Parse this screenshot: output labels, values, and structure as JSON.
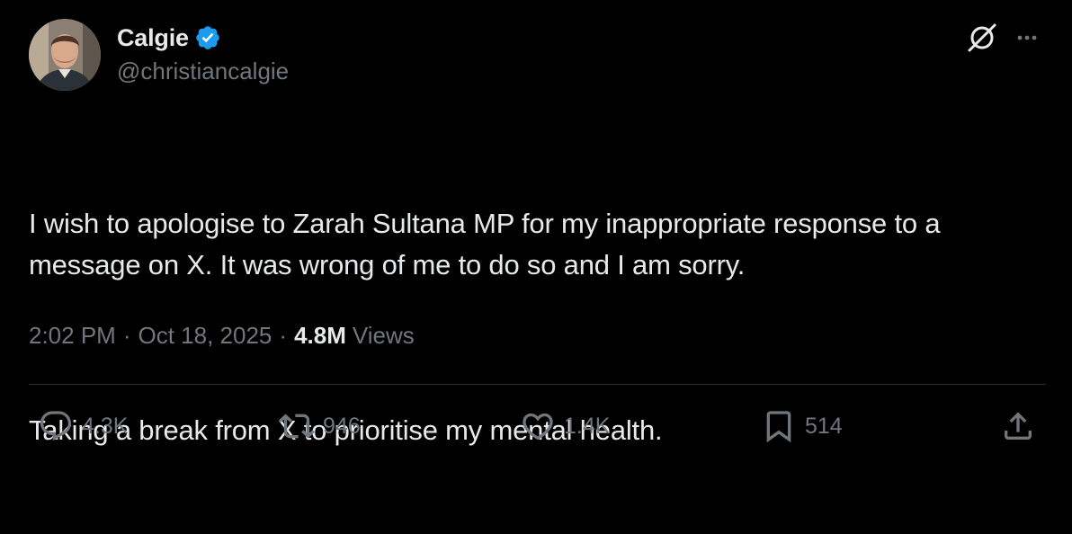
{
  "author": {
    "display_name": "Calgie",
    "handle": "@christiancalgie",
    "verified": true,
    "verified_color": "#1d9bf0"
  },
  "tweet": {
    "paragraphs": [
      "I wish to apologise to Zarah Sultana MP for my inappropriate response to a message on X. It was wrong of me to do so and I am sorry.",
      "Taking a break from X to prioritise my mental health."
    ],
    "time": "2:02 PM",
    "date": "Oct 18, 2025",
    "separator": "·",
    "views_count": "4.8M",
    "views_label": "Views"
  },
  "actions": {
    "replies": "4.3K",
    "reposts": "946",
    "likes": "1.4K",
    "bookmarks": "514"
  },
  "icons": {
    "header": [
      "grok-icon",
      "more-icon"
    ],
    "actions": [
      "reply-icon",
      "repost-icon",
      "like-icon",
      "bookmark-icon",
      "share-icon"
    ]
  },
  "colors": {
    "background": "#000000",
    "primary_text": "#e7e9ea",
    "secondary_text": "#71767b",
    "divider": "#2f3336"
  }
}
